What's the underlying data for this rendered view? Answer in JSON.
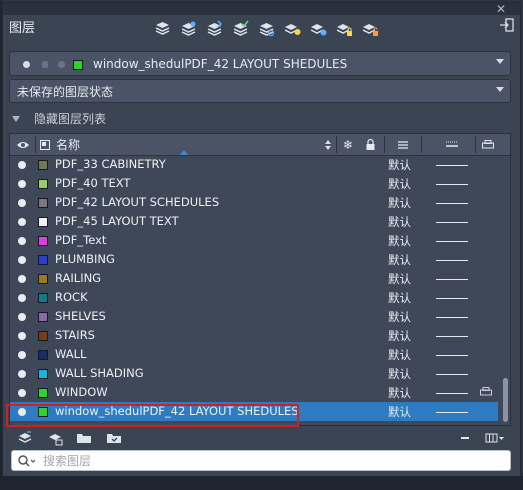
{
  "panel": {
    "title": "图层"
  },
  "layer_selector": {
    "current_layer": "window_shedulPDF_42 LAYOUT SHEDULES",
    "current_color": "#2bd62b"
  },
  "layer_state": {
    "value": "未保存的图层状态"
  },
  "hidden_list": {
    "label": "隐藏图层列表"
  },
  "table": {
    "header": {
      "name": "名称"
    },
    "rows": [
      {
        "name": "PDF_33 CABINETRY",
        "color": "#6f7a52",
        "linetype": "默认"
      },
      {
        "name": "PDF_40 TEXT",
        "color": "#9acd6a",
        "linetype": "默认"
      },
      {
        "name": "PDF_42 LAYOUT SCHEDULES",
        "color": "#7a7a7a",
        "linetype": "默认"
      },
      {
        "name": "PDF_45 LAYOUT TEXT",
        "color": "#f2f2f2",
        "linetype": "默认"
      },
      {
        "name": "PDF_Text",
        "color": "#e03ce0",
        "linetype": "默认"
      },
      {
        "name": "PLUMBING",
        "color": "#2a3fd0",
        "linetype": "默认"
      },
      {
        "name": "RAILING",
        "color": "#9e7a1c",
        "linetype": "默认"
      },
      {
        "name": "ROCK",
        "color": "#137a8a",
        "linetype": "默认"
      },
      {
        "name": "SHELVES",
        "color": "#8a6aa6",
        "linetype": "默认"
      },
      {
        "name": "STAIRS",
        "color": "#7a3e12",
        "linetype": "默认"
      },
      {
        "name": "WALL",
        "color": "#1a2a6a",
        "linetype": "默认"
      },
      {
        "name": "WALL SHADING",
        "color": "#18b6dc",
        "linetype": "默认"
      },
      {
        "name": "WINDOW",
        "color": "#2bd62b",
        "linetype": "默认"
      },
      {
        "name": "window_shedulPDF_42 LAYOUT SHEDULES",
        "color": "#2bd62b",
        "linetype": "默认",
        "selected": true
      }
    ]
  },
  "search": {
    "placeholder": "搜索图层"
  },
  "colors": {
    "panel_bg": "#3b4453",
    "selection": "#2f7bc2",
    "highlight_border": "#d0201f"
  }
}
